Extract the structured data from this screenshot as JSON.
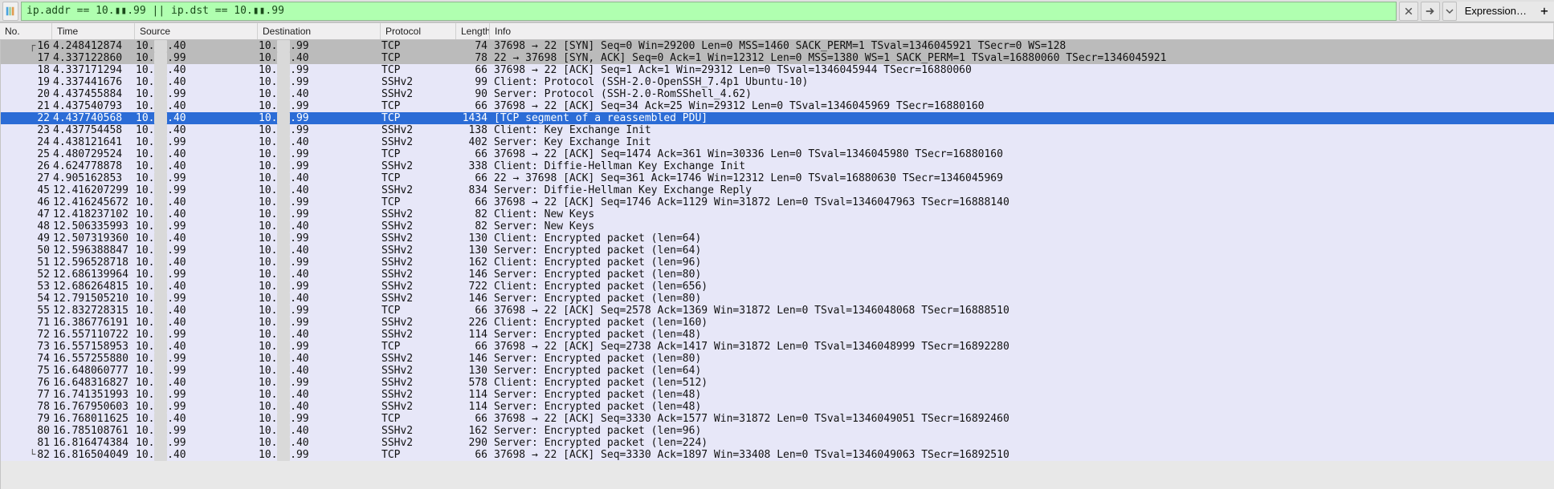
{
  "filter": {
    "value": "ip.addr == 10.▮▮.99 || ip.dst == 10.▮▮.99",
    "expression_label": "Expression…",
    "plus_label": "+"
  },
  "columns": {
    "no": "No.",
    "time": "Time",
    "source": "Source",
    "destination": "Destination",
    "protocol": "Protocol",
    "length": "Length",
    "info": "Info"
  },
  "ip_a": "10.▮▮.40",
  "ip_b": "10.▮▮.99",
  "packets": [
    {
      "no": 16,
      "time": "4.248412874",
      "src": "A",
      "dst": "B",
      "proto": "TCP",
      "len": 74,
      "info": "37698 → 22 [SYN] Seq=0 Win=29200 Len=0 MSS=1460 SACK_PERM=1 TSval=1346045921 TSecr=0 WS=128",
      "style": "gray"
    },
    {
      "no": 17,
      "time": "4.337122860",
      "src": "B",
      "dst": "A",
      "proto": "TCP",
      "len": 78,
      "info": "22 → 37698 [SYN, ACK] Seq=0 Ack=1 Win=12312 Len=0 MSS=1380 WS=1 SACK_PERM=1 TSval=16880060 TSecr=1346045921",
      "style": "gray"
    },
    {
      "no": 18,
      "time": "4.337171294",
      "src": "A",
      "dst": "B",
      "proto": "TCP",
      "len": 66,
      "info": "37698 → 22 [ACK] Seq=1 Ack=1 Win=29312 Len=0 TSval=1346045944 TSecr=16880060",
      "style": "blue"
    },
    {
      "no": 19,
      "time": "4.337441676",
      "src": "A",
      "dst": "B",
      "proto": "SSHv2",
      "len": 99,
      "info": "Client: Protocol (SSH-2.0-OpenSSH_7.4p1 Ubuntu-10)",
      "style": "blue"
    },
    {
      "no": 20,
      "time": "4.437455884",
      "src": "B",
      "dst": "A",
      "proto": "SSHv2",
      "len": 90,
      "info": "Server: Protocol (SSH-2.0-RomSShell_4.62)",
      "style": "blue"
    },
    {
      "no": 21,
      "time": "4.437540793",
      "src": "A",
      "dst": "B",
      "proto": "TCP",
      "len": 66,
      "info": "37698 → 22 [ACK] Seq=34 Ack=25 Win=29312 Len=0 TSval=1346045969 TSecr=16880160",
      "style": "blue"
    },
    {
      "no": 22,
      "time": "4.437740568",
      "src": "A",
      "dst": "B",
      "proto": "TCP",
      "len": 1434,
      "info": "[TCP segment of a reassembled PDU]",
      "style": "selected"
    },
    {
      "no": 23,
      "time": "4.437754458",
      "src": "A",
      "dst": "B",
      "proto": "SSHv2",
      "len": 138,
      "info": "Client: Key Exchange Init",
      "style": "blue"
    },
    {
      "no": 24,
      "time": "4.438121641",
      "src": "B",
      "dst": "A",
      "proto": "SSHv2",
      "len": 402,
      "info": "Server: Key Exchange Init",
      "style": "blue"
    },
    {
      "no": 25,
      "time": "4.480729524",
      "src": "A",
      "dst": "B",
      "proto": "TCP",
      "len": 66,
      "info": "37698 → 22 [ACK] Seq=1474 Ack=361 Win=30336 Len=0 TSval=1346045980 TSecr=16880160",
      "style": "blue"
    },
    {
      "no": 26,
      "time": "4.624778878",
      "src": "A",
      "dst": "B",
      "proto": "SSHv2",
      "len": 338,
      "info": "Client: Diffie-Hellman Key Exchange Init",
      "style": "blue"
    },
    {
      "no": 27,
      "time": "4.905162853",
      "src": "B",
      "dst": "A",
      "proto": "TCP",
      "len": 66,
      "info": "22 → 37698 [ACK] Seq=361 Ack=1746 Win=12312 Len=0 TSval=16880630 TSecr=1346045969",
      "style": "blue"
    },
    {
      "no": 45,
      "time": "12.416207299",
      "src": "B",
      "dst": "A",
      "proto": "SSHv2",
      "len": 834,
      "info": "Server: Diffie-Hellman Key Exchange Reply",
      "style": "blue"
    },
    {
      "no": 46,
      "time": "12.416245672",
      "src": "A",
      "dst": "B",
      "proto": "TCP",
      "len": 66,
      "info": "37698 → 22 [ACK] Seq=1746 Ack=1129 Win=31872 Len=0 TSval=1346047963 TSecr=16888140",
      "style": "blue"
    },
    {
      "no": 47,
      "time": "12.418237102",
      "src": "A",
      "dst": "B",
      "proto": "SSHv2",
      "len": 82,
      "info": "Client: New Keys",
      "style": "blue"
    },
    {
      "no": 48,
      "time": "12.506335993",
      "src": "B",
      "dst": "A",
      "proto": "SSHv2",
      "len": 82,
      "info": "Server: New Keys",
      "style": "blue"
    },
    {
      "no": 49,
      "time": "12.507319360",
      "src": "A",
      "dst": "B",
      "proto": "SSHv2",
      "len": 130,
      "info": "Client: Encrypted packet (len=64)",
      "style": "blue"
    },
    {
      "no": 50,
      "time": "12.596388847",
      "src": "B",
      "dst": "A",
      "proto": "SSHv2",
      "len": 130,
      "info": "Server: Encrypted packet (len=64)",
      "style": "blue"
    },
    {
      "no": 51,
      "time": "12.596528718",
      "src": "A",
      "dst": "B",
      "proto": "SSHv2",
      "len": 162,
      "info": "Client: Encrypted packet (len=96)",
      "style": "blue"
    },
    {
      "no": 52,
      "time": "12.686139964",
      "src": "B",
      "dst": "A",
      "proto": "SSHv2",
      "len": 146,
      "info": "Server: Encrypted packet (len=80)",
      "style": "blue"
    },
    {
      "no": 53,
      "time": "12.686264815",
      "src": "A",
      "dst": "B",
      "proto": "SSHv2",
      "len": 722,
      "info": "Client: Encrypted packet (len=656)",
      "style": "blue"
    },
    {
      "no": 54,
      "time": "12.791505210",
      "src": "B",
      "dst": "A",
      "proto": "SSHv2",
      "len": 146,
      "info": "Server: Encrypted packet (len=80)",
      "style": "blue"
    },
    {
      "no": 55,
      "time": "12.832728315",
      "src": "A",
      "dst": "B",
      "proto": "TCP",
      "len": 66,
      "info": "37698 → 22 [ACK] Seq=2578 Ack=1369 Win=31872 Len=0 TSval=1346048068 TSecr=16888510",
      "style": "blue"
    },
    {
      "no": 71,
      "time": "16.386776191",
      "src": "A",
      "dst": "B",
      "proto": "SSHv2",
      "len": 226,
      "info": "Client: Encrypted packet (len=160)",
      "style": "blue"
    },
    {
      "no": 72,
      "time": "16.557110722",
      "src": "B",
      "dst": "A",
      "proto": "SSHv2",
      "len": 114,
      "info": "Server: Encrypted packet (len=48)",
      "style": "blue"
    },
    {
      "no": 73,
      "time": "16.557158953",
      "src": "A",
      "dst": "B",
      "proto": "TCP",
      "len": 66,
      "info": "37698 → 22 [ACK] Seq=2738 Ack=1417 Win=31872 Len=0 TSval=1346048999 TSecr=16892280",
      "style": "blue"
    },
    {
      "no": 74,
      "time": "16.557255880",
      "src": "B",
      "dst": "A",
      "proto": "SSHv2",
      "len": 146,
      "info": "Server: Encrypted packet (len=80)",
      "style": "blue"
    },
    {
      "no": 75,
      "time": "16.648060777",
      "src": "B",
      "dst": "A",
      "proto": "SSHv2",
      "len": 130,
      "info": "Server: Encrypted packet (len=64)",
      "style": "blue"
    },
    {
      "no": 76,
      "time": "16.648316827",
      "src": "A",
      "dst": "B",
      "proto": "SSHv2",
      "len": 578,
      "info": "Client: Encrypted packet (len=512)",
      "style": "blue"
    },
    {
      "no": 77,
      "time": "16.741351993",
      "src": "B",
      "dst": "A",
      "proto": "SSHv2",
      "len": 114,
      "info": "Server: Encrypted packet (len=48)",
      "style": "blue"
    },
    {
      "no": 78,
      "time": "16.767950603",
      "src": "B",
      "dst": "A",
      "proto": "SSHv2",
      "len": 114,
      "info": "Server: Encrypted packet (len=48)",
      "style": "blue"
    },
    {
      "no": 79,
      "time": "16.768011625",
      "src": "A",
      "dst": "B",
      "proto": "TCP",
      "len": 66,
      "info": "37698 → 22 [ACK] Seq=3330 Ack=1577 Win=31872 Len=0 TSval=1346049051 TSecr=16892460",
      "style": "blue"
    },
    {
      "no": 80,
      "time": "16.785108761",
      "src": "B",
      "dst": "A",
      "proto": "SSHv2",
      "len": 162,
      "info": "Server: Encrypted packet (len=96)",
      "style": "blue"
    },
    {
      "no": 81,
      "time": "16.816474384",
      "src": "B",
      "dst": "A",
      "proto": "SSHv2",
      "len": 290,
      "info": "Server: Encrypted packet (len=224)",
      "style": "blue"
    },
    {
      "no": 82,
      "time": "16.816504049",
      "src": "A",
      "dst": "B",
      "proto": "TCP",
      "len": 66,
      "info": "37698 → 22 [ACK] Seq=3330 Ack=1897 Win=33408 Len=0 TSval=1346049063 TSecr=16892510",
      "style": "blue"
    }
  ]
}
